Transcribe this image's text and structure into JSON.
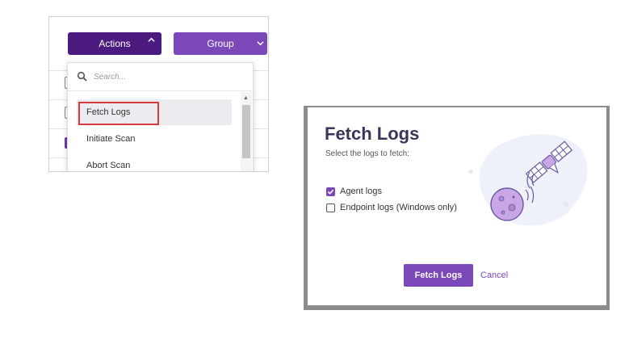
{
  "toolbar": {
    "actions_label": "Actions",
    "group_label": "Group"
  },
  "dropdown": {
    "search_placeholder": "Search...",
    "items": [
      {
        "label": "Fetch Logs"
      },
      {
        "label": "Initiate Scan"
      },
      {
        "label": "Abort Scan"
      }
    ]
  },
  "modal": {
    "title": "Fetch Logs",
    "subtitle": "Select the logs to fetch:",
    "options": [
      {
        "label": "Agent logs",
        "checked": true
      },
      {
        "label": "Endpoint logs (Windows only)",
        "checked": false
      }
    ],
    "fetch_label": "Fetch Logs",
    "cancel_label": "Cancel"
  },
  "colors": {
    "dark_purple": "#4a1a7e",
    "purple": "#7a48b8",
    "highlight_red": "#d93a3a",
    "title": "#3b3659"
  }
}
